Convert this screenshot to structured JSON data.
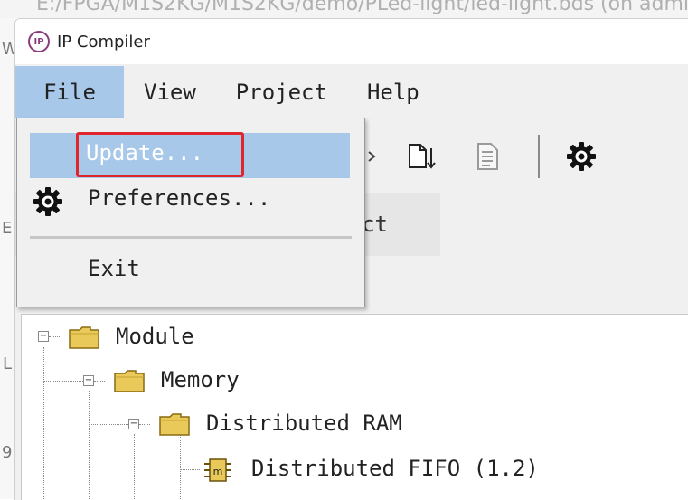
{
  "background": {
    "path_text": "E:/FPGA/M1S2KG/M1S2KG/demo/PLed-light/led-light.bds (on admin",
    "left_marks": [
      "W",
      "E",
      "L",
      "9"
    ]
  },
  "window": {
    "logo_text": "IP",
    "title": "IP Compiler"
  },
  "menubar": {
    "items": [
      "File",
      "View",
      "Project",
      "Help"
    ]
  },
  "tabs": {
    "partial_label": "ct"
  },
  "file_menu": {
    "update_label": "Update...",
    "preferences_label": "Preferences...",
    "exit_label": "Exit"
  },
  "tree": {
    "nodes": [
      {
        "label": "Module"
      },
      {
        "label": "Memory"
      },
      {
        "label": "Distributed RAM"
      },
      {
        "label": "Distributed FIFO (1.2)"
      }
    ]
  },
  "colors": {
    "highlight": "#a7c8e8",
    "annotation_red": "#e0262c",
    "logo": "#8a3b7a"
  }
}
